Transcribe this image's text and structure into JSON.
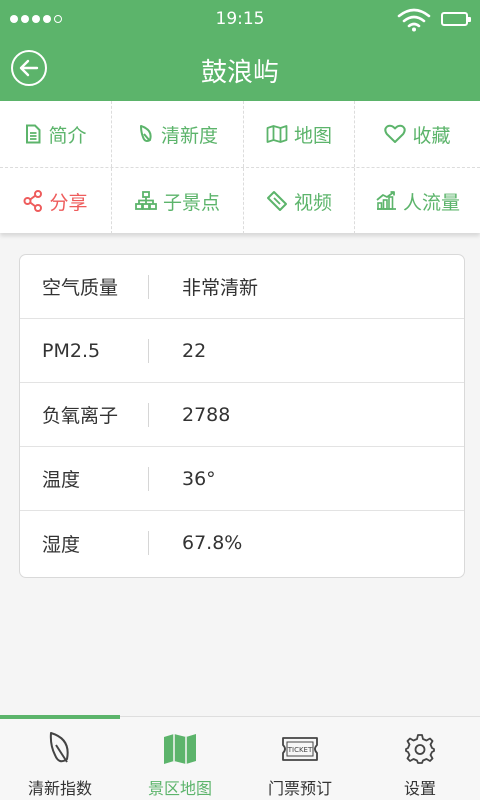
{
  "status_bar": {
    "time": "19:15"
  },
  "header": {
    "title": "鼓浪屿"
  },
  "menu": {
    "row1": [
      "简介",
      "清新度",
      "地图",
      "收藏"
    ],
    "row2": [
      "分享",
      "子景点",
      "视频",
      "人流量"
    ]
  },
  "info": [
    {
      "label": "空气质量",
      "value": "非常清新"
    },
    {
      "label": "PM2.5",
      "value": "22"
    },
    {
      "label": "负氧离子",
      "value": "2788"
    },
    {
      "label": "温度",
      "value": "36°"
    },
    {
      "label": "湿度",
      "value": "67.8%"
    }
  ],
  "tabs": [
    "清新指数",
    "景区地图",
    "门票预订",
    "设置"
  ],
  "colors": {
    "primary": "#5cb46b",
    "share": "#ee5c5c"
  },
  "icons": [
    "back-arrow-icon",
    "document-icon",
    "leaf-icon",
    "map-icon",
    "heart-icon",
    "share-icon",
    "sitemap-icon",
    "ticket-tag-icon",
    "chart-icon",
    "gear-icon"
  ]
}
